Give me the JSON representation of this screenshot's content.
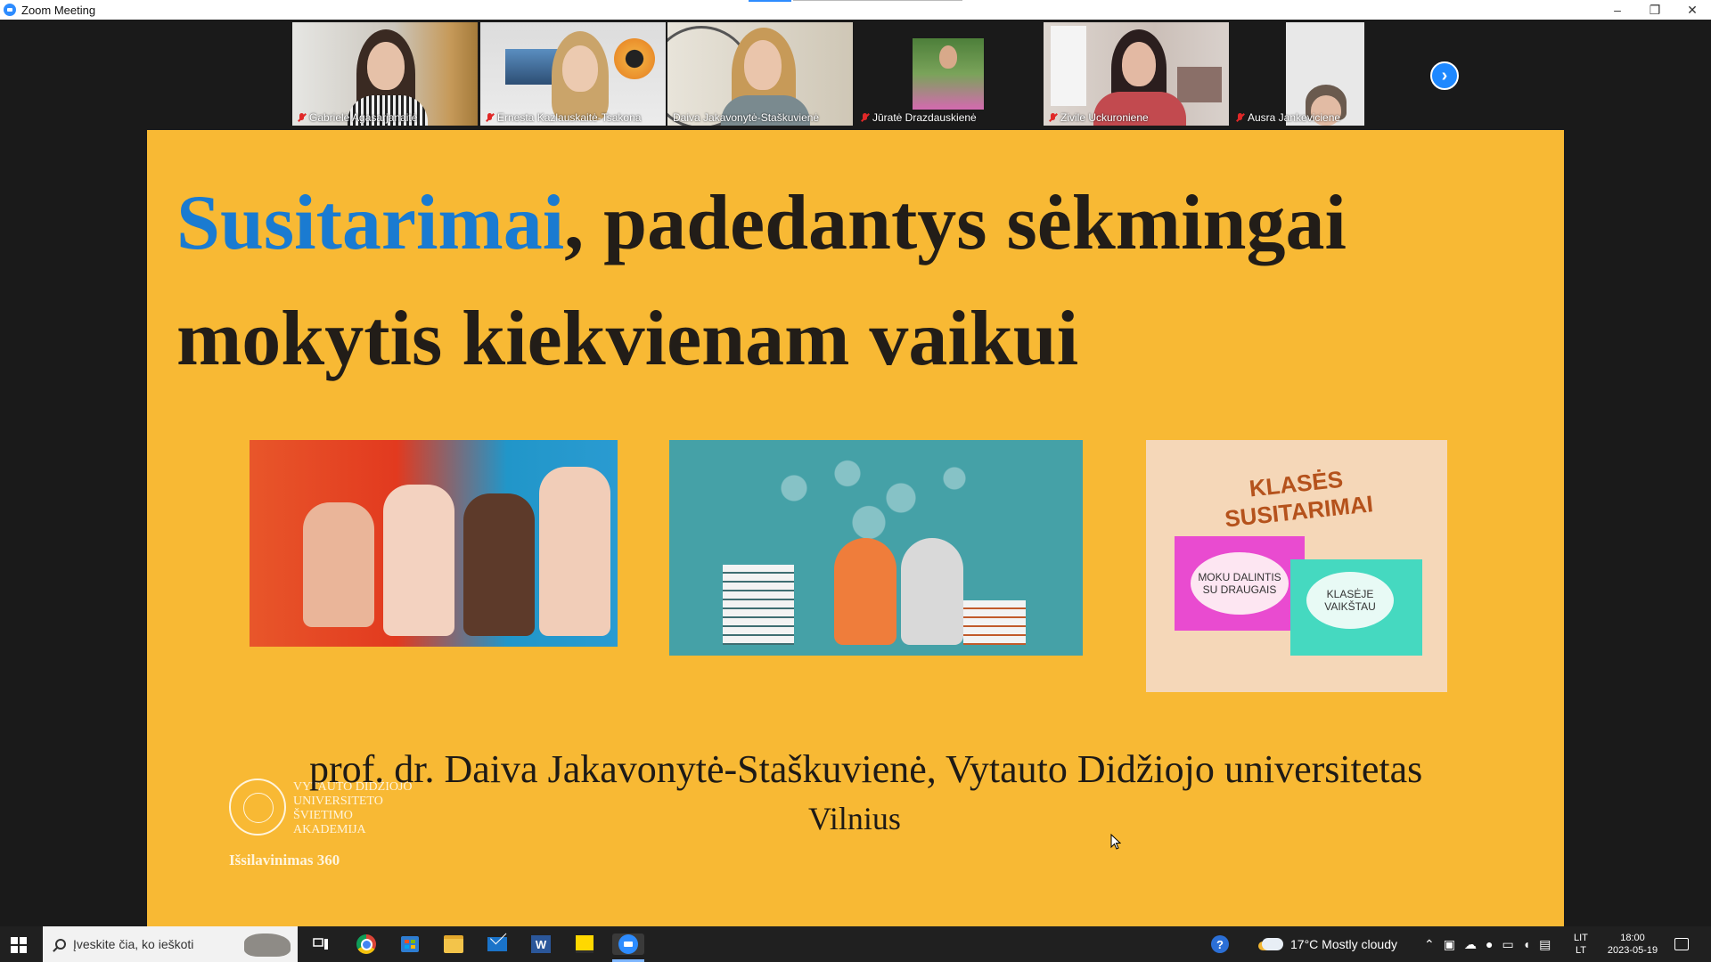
{
  "window": {
    "title": "Zoom Meeting",
    "minimize": "–",
    "restore": "❐",
    "close": "✕"
  },
  "participants": [
    {
      "name": "Gabrielė Agasarjanaitė",
      "muted": true
    },
    {
      "name": "Ernesta Kazlauskaitė-Tsakona",
      "muted": true
    },
    {
      "name": "Daiva Jakavonytė-Staškuvienė",
      "muted": false
    },
    {
      "name": "Jūratė Drazdauskienė",
      "muted": true
    },
    {
      "name": "Zivile Uckuroniene",
      "muted": true
    },
    {
      "name": "Ausra Jankeviciene",
      "muted": true
    }
  ],
  "next_arrow": "›",
  "slide": {
    "title_accent": "Susitarimai",
    "title_rest": ", padedantys sėkmingai mokytis kiekvienam vaikui",
    "author": "prof. dr. Daiva Jakavonytė-Staškuvienė, Vytauto Didžiojo universitetas",
    "city": "Vilnius",
    "logo_lines": [
      "VYTAUTO DIDŽIOJO",
      "UNIVERSITETO",
      "ŠVIETIMO",
      "AKADEMIJA"
    ],
    "logo_sub": "Išsilavinimas 360",
    "poster": {
      "heading": "KLASĖS SUSITARIMAI",
      "card1": "MOKU DALINTIS SU DRAUGAIS",
      "card2": "KLASĖJE VAIKŠTAU"
    }
  },
  "taskbar": {
    "search_placeholder": "Įveskite čia, ko ieškoti",
    "weather": "17°C  Mostly cloudy",
    "lang_top": "LIT",
    "lang_bottom": "LT",
    "time": "18:00",
    "date": "2023-05-19",
    "help_badge": "?"
  },
  "colors": {
    "slide_bg": "#f8b934",
    "accent": "#1a7bd1",
    "zoom_blue": "#2d8cff"
  }
}
